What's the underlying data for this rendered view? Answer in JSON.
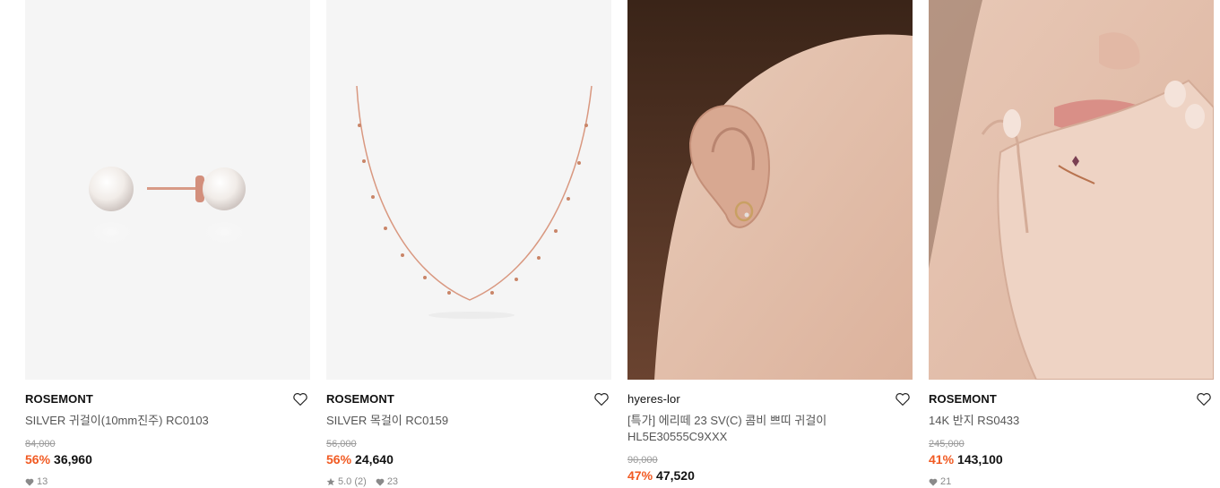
{
  "products": [
    {
      "image_alt": "pearl stud earrings",
      "brand": "ROSEMONT",
      "title": "SILVER 귀걸이(10mm진주) RC0103",
      "title2": "",
      "original_price": "84,000",
      "discount": "56%",
      "price": "36,960",
      "rating": "",
      "review_count": "",
      "likes": "13",
      "wish_icon": "heart-outline-icon"
    },
    {
      "image_alt": "rose gold beaded chain necklace",
      "brand": "ROSEMONT",
      "title": "SILVER 목걸이 RC0159",
      "title2": "",
      "original_price": "56,000",
      "discount": "56%",
      "price": "24,640",
      "rating": "5.0",
      "review_count": "(2)",
      "likes": "23",
      "wish_icon": "heart-outline-icon"
    },
    {
      "image_alt": "model wearing stud earring",
      "brand": "hyeres-lor",
      "title": "[특가] 에리떼 23 SV(C) 콤비 쁘띠 귀걸이",
      "title2": "HL5E30555C9XXX",
      "original_price": "90,000",
      "discount": "47%",
      "price": "47,520",
      "rating": "",
      "review_count": "",
      "likes": "",
      "wish_icon": "heart-outline-icon"
    },
    {
      "image_alt": "model wearing ring",
      "brand": "ROSEMONT",
      "title": "14K 반지 RS0433",
      "title2": "",
      "original_price": "245,000",
      "discount": "41%",
      "price": "143,100",
      "rating": "",
      "review_count": "",
      "likes": "21",
      "wish_icon": "heart-outline-icon"
    }
  ],
  "colors": {
    "discount": "#f15a22",
    "image_bg": "#f5f5f5"
  }
}
